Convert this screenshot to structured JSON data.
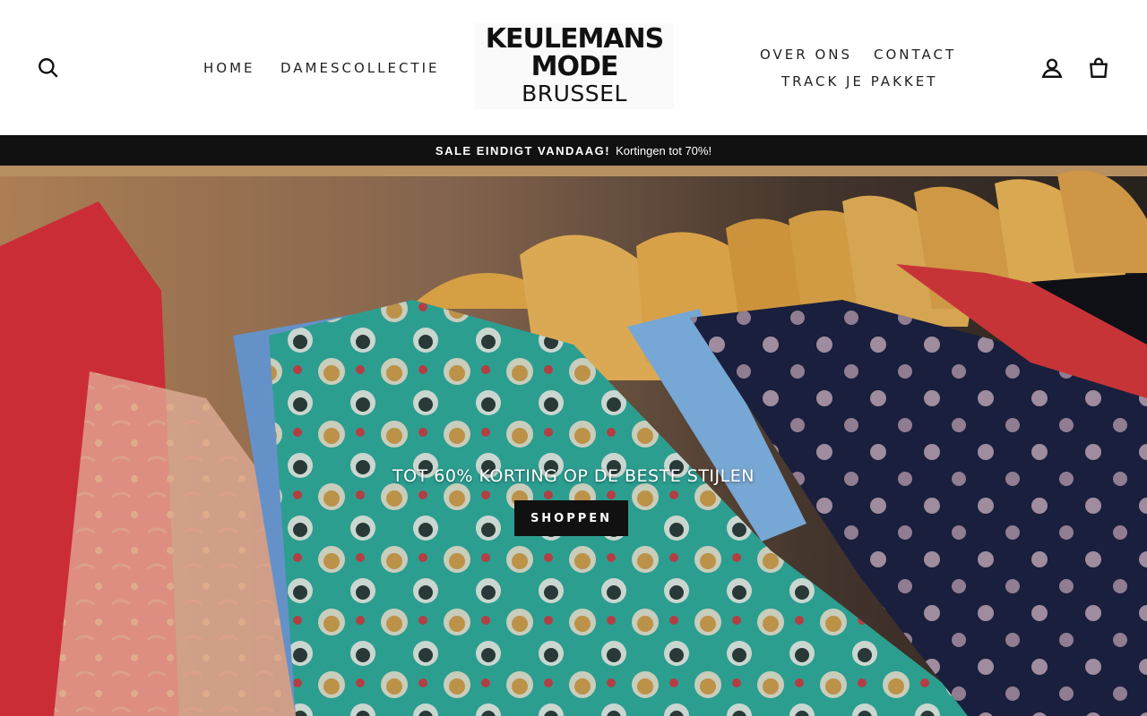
{
  "header": {
    "logo": {
      "line1": "KEULEMANS",
      "line2": "MODE",
      "line3": "BRUSSEL"
    },
    "nav_left": [
      {
        "label": "HOME"
      },
      {
        "label": "DAMESCOLLECTIE"
      }
    ],
    "nav_right": [
      {
        "label": "OVER ONS"
      },
      {
        "label": "CONTACT"
      },
      {
        "label": "TRACK JE PAKKET"
      }
    ],
    "icons": {
      "search": "search-icon",
      "account": "account-icon",
      "cart": "cart-icon"
    }
  },
  "announcement": {
    "strong": "SALE EINDIGT VANDAAG!",
    "text": "Kortingen tot 70%!"
  },
  "hero": {
    "title": "TOT 60% KORTING OP DE BESTE STIJLEN",
    "button": "SHOPPEN"
  },
  "colors": {
    "announcement_bg": "#111111",
    "button_bg": "#111111",
    "text": "#222222"
  }
}
